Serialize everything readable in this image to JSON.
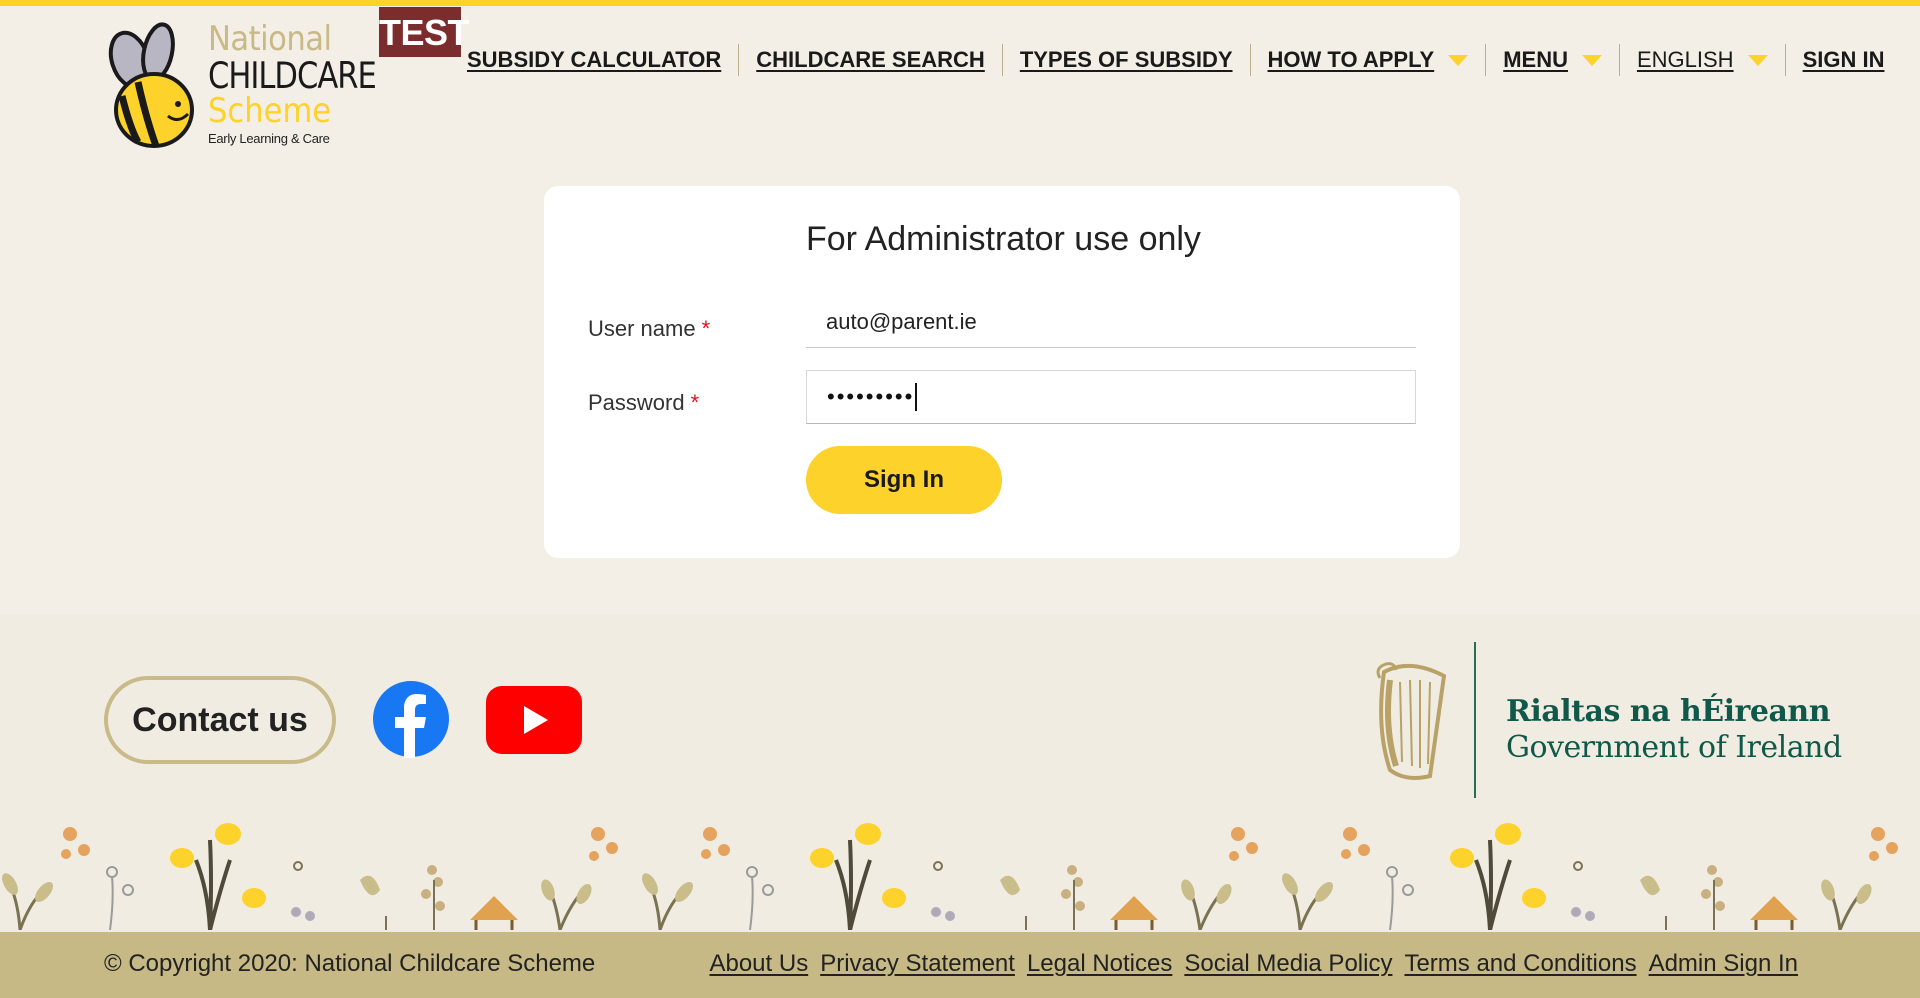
{
  "logo": {
    "line1": "National",
    "line2": "CHILDCARE",
    "line3": "Scheme",
    "tagline": "Early Learning & Care"
  },
  "env_badge": "TEST",
  "nav": {
    "items": [
      {
        "label": "SUBSIDY CALCULATOR",
        "dropdown": false
      },
      {
        "label": "CHILDCARE SEARCH",
        "dropdown": false
      },
      {
        "label": "TYPES OF SUBSIDY",
        "dropdown": false
      },
      {
        "label": "HOW TO APPLY",
        "dropdown": true
      },
      {
        "label": "MENU",
        "dropdown": true
      },
      {
        "label": "ENGLISH",
        "dropdown": true
      },
      {
        "label": "SIGN IN",
        "dropdown": false
      }
    ]
  },
  "login": {
    "title": "For Administrator use only",
    "username_label": "User name",
    "username_value": "auto@parent.ie",
    "password_label": "Password",
    "password_masked": "•••••••••",
    "required_marker": "*",
    "submit_label": "Sign In"
  },
  "footer": {
    "contact_label": "Contact us",
    "social": [
      {
        "name": "facebook-icon",
        "color": "#1877f2"
      },
      {
        "name": "youtube-icon",
        "color": "#ff0000"
      }
    ],
    "gov_irish": "Rialtas na hÉireann",
    "gov_english": "Government of Ireland",
    "copyright": "© Copyright 2020: National Childcare Scheme",
    "links": [
      "About Us",
      "Privacy Statement",
      "Legal Notices",
      "Social Media Policy",
      "Terms and Conditions",
      "Admin Sign In"
    ]
  },
  "colors": {
    "accent_yellow": "#fdd22b",
    "background": "#f3efe6",
    "footer_bar": "#c6b985",
    "test_badge": "#7b2d2d",
    "gov_green": "#10584a"
  }
}
